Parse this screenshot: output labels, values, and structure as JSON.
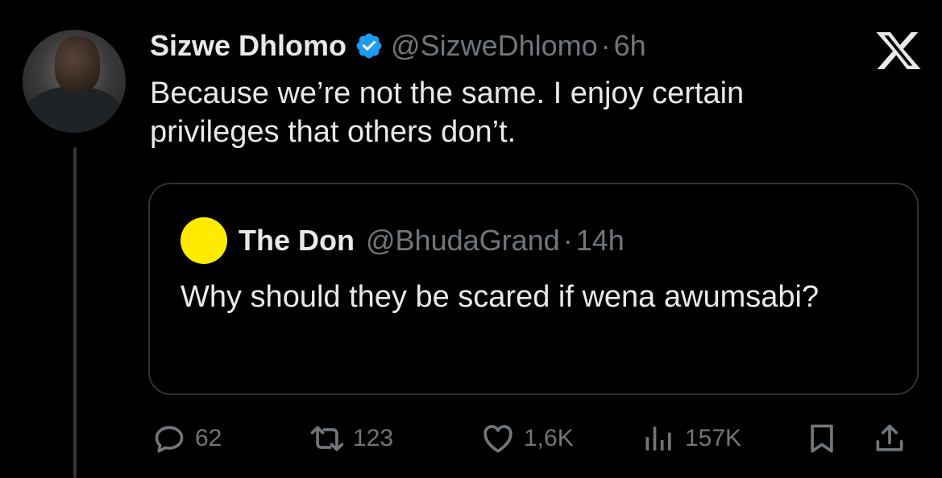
{
  "author": {
    "name": "Sizwe Dhlomo",
    "handle": "@SizweDhlomo",
    "separator": "·",
    "time": "6h",
    "verified": true
  },
  "tweet_text": "Because we’re not the same. I enjoy certain privileges that others don’t.",
  "quote": {
    "name": "The Don",
    "handle": "@BhudaGrand",
    "separator": "·",
    "time": "14h",
    "text": "Why should they be scared if wena awumsabi?",
    "avatar_color": "#ffeb00"
  },
  "actions": {
    "replies": "62",
    "retweets": "123",
    "likes": "1,6K",
    "views": "157K"
  },
  "colors": {
    "background": "#000000",
    "text": "#e7e9ea",
    "muted": "#71767b",
    "verified": "#1d9bf0",
    "border": "#2f3336"
  },
  "icons": [
    "x-logo-icon",
    "verified-badge-icon",
    "reply-icon",
    "retweet-icon",
    "like-icon",
    "views-icon",
    "bookmark-icon",
    "share-icon"
  ]
}
